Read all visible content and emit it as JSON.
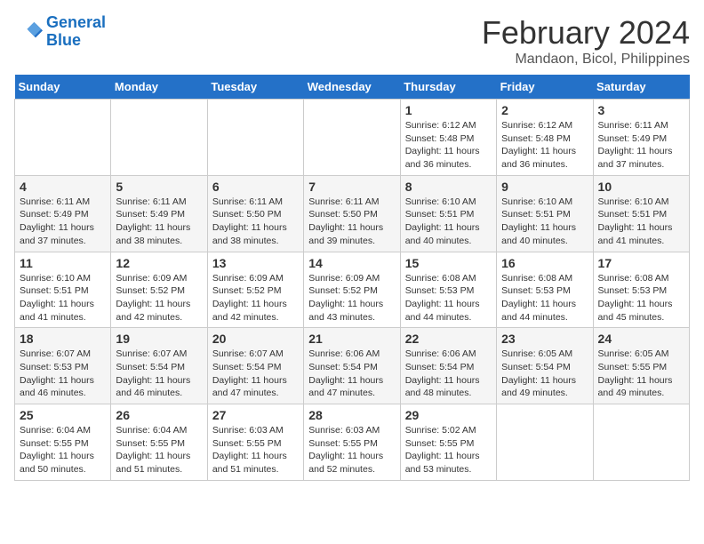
{
  "header": {
    "logo_line1": "General",
    "logo_line2": "Blue",
    "month": "February 2024",
    "location": "Mandaon, Bicol, Philippines"
  },
  "weekdays": [
    "Sunday",
    "Monday",
    "Tuesday",
    "Wednesday",
    "Thursday",
    "Friday",
    "Saturday"
  ],
  "weeks": [
    [
      {
        "day": "",
        "info": ""
      },
      {
        "day": "",
        "info": ""
      },
      {
        "day": "",
        "info": ""
      },
      {
        "day": "",
        "info": ""
      },
      {
        "day": "1",
        "info": "Sunrise: 6:12 AM\nSunset: 5:48 PM\nDaylight: 11 hours\nand 36 minutes."
      },
      {
        "day": "2",
        "info": "Sunrise: 6:12 AM\nSunset: 5:48 PM\nDaylight: 11 hours\nand 36 minutes."
      },
      {
        "day": "3",
        "info": "Sunrise: 6:11 AM\nSunset: 5:49 PM\nDaylight: 11 hours\nand 37 minutes."
      }
    ],
    [
      {
        "day": "4",
        "info": "Sunrise: 6:11 AM\nSunset: 5:49 PM\nDaylight: 11 hours\nand 37 minutes."
      },
      {
        "day": "5",
        "info": "Sunrise: 6:11 AM\nSunset: 5:49 PM\nDaylight: 11 hours\nand 38 minutes."
      },
      {
        "day": "6",
        "info": "Sunrise: 6:11 AM\nSunset: 5:50 PM\nDaylight: 11 hours\nand 38 minutes."
      },
      {
        "day": "7",
        "info": "Sunrise: 6:11 AM\nSunset: 5:50 PM\nDaylight: 11 hours\nand 39 minutes."
      },
      {
        "day": "8",
        "info": "Sunrise: 6:10 AM\nSunset: 5:51 PM\nDaylight: 11 hours\nand 40 minutes."
      },
      {
        "day": "9",
        "info": "Sunrise: 6:10 AM\nSunset: 5:51 PM\nDaylight: 11 hours\nand 40 minutes."
      },
      {
        "day": "10",
        "info": "Sunrise: 6:10 AM\nSunset: 5:51 PM\nDaylight: 11 hours\nand 41 minutes."
      }
    ],
    [
      {
        "day": "11",
        "info": "Sunrise: 6:10 AM\nSunset: 5:51 PM\nDaylight: 11 hours\nand 41 minutes."
      },
      {
        "day": "12",
        "info": "Sunrise: 6:09 AM\nSunset: 5:52 PM\nDaylight: 11 hours\nand 42 minutes."
      },
      {
        "day": "13",
        "info": "Sunrise: 6:09 AM\nSunset: 5:52 PM\nDaylight: 11 hours\nand 42 minutes."
      },
      {
        "day": "14",
        "info": "Sunrise: 6:09 AM\nSunset: 5:52 PM\nDaylight: 11 hours\nand 43 minutes."
      },
      {
        "day": "15",
        "info": "Sunrise: 6:08 AM\nSunset: 5:53 PM\nDaylight: 11 hours\nand 44 minutes."
      },
      {
        "day": "16",
        "info": "Sunrise: 6:08 AM\nSunset: 5:53 PM\nDaylight: 11 hours\nand 44 minutes."
      },
      {
        "day": "17",
        "info": "Sunrise: 6:08 AM\nSunset: 5:53 PM\nDaylight: 11 hours\nand 45 minutes."
      }
    ],
    [
      {
        "day": "18",
        "info": "Sunrise: 6:07 AM\nSunset: 5:53 PM\nDaylight: 11 hours\nand 46 minutes."
      },
      {
        "day": "19",
        "info": "Sunrise: 6:07 AM\nSunset: 5:54 PM\nDaylight: 11 hours\nand 46 minutes."
      },
      {
        "day": "20",
        "info": "Sunrise: 6:07 AM\nSunset: 5:54 PM\nDaylight: 11 hours\nand 47 minutes."
      },
      {
        "day": "21",
        "info": "Sunrise: 6:06 AM\nSunset: 5:54 PM\nDaylight: 11 hours\nand 47 minutes."
      },
      {
        "day": "22",
        "info": "Sunrise: 6:06 AM\nSunset: 5:54 PM\nDaylight: 11 hours\nand 48 minutes."
      },
      {
        "day": "23",
        "info": "Sunrise: 6:05 AM\nSunset: 5:54 PM\nDaylight: 11 hours\nand 49 minutes."
      },
      {
        "day": "24",
        "info": "Sunrise: 6:05 AM\nSunset: 5:55 PM\nDaylight: 11 hours\nand 49 minutes."
      }
    ],
    [
      {
        "day": "25",
        "info": "Sunrise: 6:04 AM\nSunset: 5:55 PM\nDaylight: 11 hours\nand 50 minutes."
      },
      {
        "day": "26",
        "info": "Sunrise: 6:04 AM\nSunset: 5:55 PM\nDaylight: 11 hours\nand 51 minutes."
      },
      {
        "day": "27",
        "info": "Sunrise: 6:03 AM\nSunset: 5:55 PM\nDaylight: 11 hours\nand 51 minutes."
      },
      {
        "day": "28",
        "info": "Sunrise: 6:03 AM\nSunset: 5:55 PM\nDaylight: 11 hours\nand 52 minutes."
      },
      {
        "day": "29",
        "info": "Sunrise: 5:02 AM\nSunset: 5:55 PM\nDaylight: 11 hours\nand 53 minutes."
      },
      {
        "day": "",
        "info": ""
      },
      {
        "day": "",
        "info": ""
      }
    ]
  ]
}
